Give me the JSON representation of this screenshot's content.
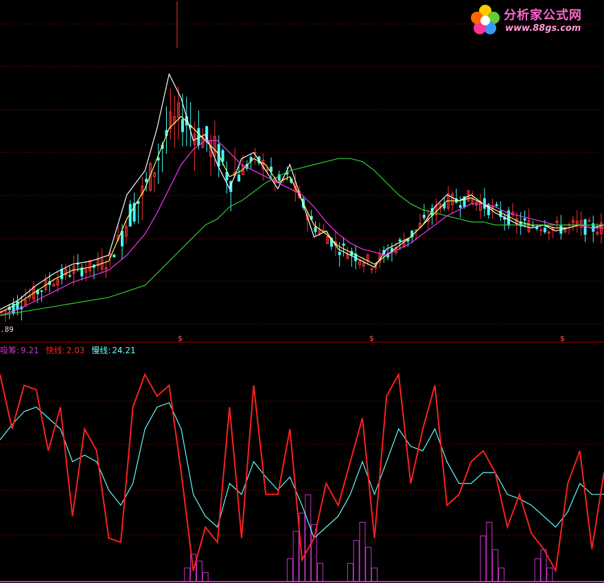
{
  "colors": {
    "background": "#000000",
    "grid": "#7a0000",
    "divider": "#aa0000",
    "candle_up": "#ff3030",
    "candle_down": "#40ffff",
    "ma_white": "#ffffff",
    "ma_yellow": "#ffff66",
    "ma_magenta": "#ff33ff",
    "ma_green": "#33cc33",
    "xichou": "#cc33cc",
    "fast": "#ff2020",
    "slow": "#66ffff"
  },
  "logo": {
    "title": "分析家公式网",
    "url": "www.88gs.com",
    "icon": "flower-logo-icon"
  },
  "price_panel": {
    "low_label": ".89"
  },
  "signals": {
    "marker": "$",
    "positions": [
      0.3,
      0.615,
      0.93
    ]
  },
  "indicator": {
    "xichou_label": "吸筹:",
    "xichou_value": "9.21",
    "fast_label": "快线:",
    "fast_value": "2.03",
    "slow_label": "慢线:",
    "slow_value": "24.21"
  },
  "chart_data": [
    {
      "type": "candlestick",
      "title": "",
      "series": [
        {
          "name": "",
          "kind": "ma_white",
          "x": [
            0,
            0.03,
            0.06,
            0.09,
            0.12,
            0.15,
            0.18,
            0.21,
            0.24,
            0.26,
            0.28,
            0.3,
            0.32,
            0.34,
            0.36,
            0.38,
            0.4,
            0.42,
            0.44,
            0.46,
            0.48,
            0.5,
            0.52,
            0.54,
            0.56,
            0.58,
            0.6,
            0.62,
            0.64,
            0.66,
            0.68,
            0.7,
            0.72,
            0.74,
            0.76,
            0.78,
            0.8,
            0.82,
            0.84,
            0.86,
            0.88,
            0.9,
            0.92,
            0.94,
            0.96,
            0.98,
            1.0
          ],
          "y": [
            0.02,
            0.05,
            0.1,
            0.14,
            0.17,
            0.18,
            0.2,
            0.4,
            0.48,
            0.62,
            0.8,
            0.72,
            0.58,
            0.6,
            0.5,
            0.42,
            0.52,
            0.54,
            0.48,
            0.42,
            0.5,
            0.38,
            0.26,
            0.28,
            0.22,
            0.2,
            0.18,
            0.16,
            0.22,
            0.24,
            0.26,
            0.3,
            0.36,
            0.4,
            0.38,
            0.4,
            0.37,
            0.34,
            0.32,
            0.3,
            0.29,
            0.3,
            0.28,
            0.29,
            0.3,
            0.29,
            0.3
          ]
        },
        {
          "name": "",
          "kind": "ma_yellow",
          "x": [
            0,
            0.03,
            0.06,
            0.09,
            0.12,
            0.15,
            0.18,
            0.21,
            0.24,
            0.26,
            0.28,
            0.3,
            0.32,
            0.34,
            0.36,
            0.38,
            0.4,
            0.42,
            0.44,
            0.46,
            0.48,
            0.5,
            0.52,
            0.54,
            0.56,
            0.58,
            0.6,
            0.62,
            0.64,
            0.66,
            0.68,
            0.7,
            0.72,
            0.74,
            0.76,
            0.78,
            0.8,
            0.82,
            0.84,
            0.86,
            0.88,
            0.9,
            0.92,
            0.94,
            0.96,
            0.98,
            1.0
          ],
          "y": [
            0.01,
            0.04,
            0.08,
            0.12,
            0.15,
            0.16,
            0.18,
            0.32,
            0.42,
            0.52,
            0.62,
            0.66,
            0.62,
            0.58,
            0.54,
            0.46,
            0.48,
            0.52,
            0.5,
            0.44,
            0.46,
            0.38,
            0.3,
            0.27,
            0.23,
            0.21,
            0.19,
            0.17,
            0.2,
            0.23,
            0.26,
            0.3,
            0.34,
            0.38,
            0.38,
            0.39,
            0.37,
            0.35,
            0.33,
            0.31,
            0.3,
            0.3,
            0.29,
            0.29,
            0.3,
            0.29,
            0.29
          ]
        },
        {
          "name": "",
          "kind": "ma_magenta",
          "x": [
            0,
            0.03,
            0.06,
            0.09,
            0.12,
            0.15,
            0.18,
            0.21,
            0.24,
            0.26,
            0.28,
            0.3,
            0.32,
            0.34,
            0.36,
            0.38,
            0.4,
            0.42,
            0.44,
            0.46,
            0.48,
            0.5,
            0.52,
            0.54,
            0.56,
            0.58,
            0.6,
            0.62,
            0.64,
            0.66,
            0.68,
            0.7,
            0.72,
            0.74,
            0.76,
            0.78,
            0.8,
            0.82,
            0.84,
            0.86,
            0.88,
            0.9,
            0.92,
            0.94,
            0.96,
            0.98,
            1.0
          ],
          "y": [
            0.0,
            0.02,
            0.05,
            0.08,
            0.11,
            0.13,
            0.15,
            0.2,
            0.27,
            0.34,
            0.42,
            0.5,
            0.55,
            0.58,
            0.58,
            0.54,
            0.5,
            0.48,
            0.46,
            0.44,
            0.42,
            0.4,
            0.36,
            0.31,
            0.27,
            0.24,
            0.22,
            0.21,
            0.2,
            0.22,
            0.24,
            0.27,
            0.3,
            0.33,
            0.35,
            0.37,
            0.37,
            0.36,
            0.34,
            0.33,
            0.32,
            0.31,
            0.3,
            0.3,
            0.3,
            0.29,
            0.29
          ]
        },
        {
          "name": "",
          "kind": "ma_green",
          "x": [
            0,
            0.03,
            0.06,
            0.09,
            0.12,
            0.15,
            0.18,
            0.21,
            0.24,
            0.26,
            0.28,
            0.3,
            0.32,
            0.34,
            0.36,
            0.38,
            0.4,
            0.42,
            0.44,
            0.46,
            0.48,
            0.5,
            0.52,
            0.54,
            0.56,
            0.58,
            0.6,
            0.62,
            0.64,
            0.66,
            0.68,
            0.7,
            0.72,
            0.74,
            0.76,
            0.78,
            0.8,
            0.82,
            0.84,
            0.86,
            0.88,
            0.9,
            0.92,
            0.94,
            0.96,
            0.98,
            1.0
          ],
          "y": [
            0.0,
            0.01,
            0.02,
            0.03,
            0.04,
            0.05,
            0.06,
            0.08,
            0.1,
            0.14,
            0.18,
            0.22,
            0.26,
            0.3,
            0.32,
            0.36,
            0.38,
            0.41,
            0.44,
            0.46,
            0.48,
            0.49,
            0.5,
            0.51,
            0.52,
            0.52,
            0.51,
            0.48,
            0.44,
            0.4,
            0.37,
            0.35,
            0.34,
            0.33,
            0.32,
            0.31,
            0.31,
            0.3,
            0.3,
            0.3,
            0.3,
            0.3,
            0.3,
            0.3,
            0.3,
            0.3,
            0.3
          ]
        }
      ]
    },
    {
      "type": "line",
      "title": "",
      "series": [
        {
          "name": "快线",
          "kind": "fast",
          "x": [
            0,
            0.02,
            0.04,
            0.06,
            0.08,
            0.1,
            0.12,
            0.14,
            0.16,
            0.18,
            0.2,
            0.22,
            0.24,
            0.26,
            0.28,
            0.3,
            0.32,
            0.34,
            0.36,
            0.38,
            0.4,
            0.42,
            0.44,
            0.46,
            0.48,
            0.5,
            0.52,
            0.54,
            0.56,
            0.58,
            0.6,
            0.62,
            0.64,
            0.66,
            0.68,
            0.7,
            0.72,
            0.74,
            0.76,
            0.78,
            0.8,
            0.82,
            0.84,
            0.86,
            0.88,
            0.9,
            0.92,
            0.94,
            0.96,
            0.98,
            1.0
          ],
          "y": [
            95,
            70,
            90,
            88,
            60,
            80,
            30,
            70,
            60,
            20,
            18,
            80,
            95,
            85,
            90,
            50,
            5,
            25,
            18,
            80,
            20,
            90,
            40,
            40,
            70,
            10,
            20,
            45,
            35,
            55,
            75,
            20,
            85,
            95,
            45,
            70,
            90,
            35,
            40,
            55,
            60,
            50,
            25,
            40,
            22,
            15,
            5,
            45,
            60,
            15,
            50
          ],
          "ylim": [
            0,
            100
          ]
        },
        {
          "name": "慢线",
          "kind": "slow",
          "x": [
            0,
            0.02,
            0.04,
            0.06,
            0.08,
            0.1,
            0.12,
            0.14,
            0.16,
            0.18,
            0.2,
            0.22,
            0.24,
            0.26,
            0.28,
            0.3,
            0.32,
            0.34,
            0.36,
            0.38,
            0.4,
            0.42,
            0.44,
            0.46,
            0.48,
            0.5,
            0.52,
            0.54,
            0.56,
            0.58,
            0.6,
            0.62,
            0.64,
            0.66,
            0.68,
            0.7,
            0.72,
            0.74,
            0.76,
            0.78,
            0.8,
            0.82,
            0.84,
            0.86,
            0.88,
            0.9,
            0.92,
            0.94,
            0.96,
            0.98,
            1.0
          ],
          "y": [
            65,
            72,
            78,
            80,
            75,
            70,
            55,
            58,
            55,
            42,
            35,
            45,
            70,
            80,
            82,
            70,
            40,
            30,
            25,
            45,
            40,
            55,
            48,
            42,
            48,
            35,
            20,
            25,
            30,
            40,
            55,
            40,
            55,
            70,
            62,
            60,
            70,
            55,
            45,
            45,
            50,
            50,
            40,
            38,
            35,
            30,
            25,
            32,
            45,
            40,
            40
          ],
          "ylim": [
            0,
            100
          ]
        },
        {
          "name": "吸筹",
          "kind": "xichou",
          "x": [
            0.31,
            0.32,
            0.33,
            0.34,
            0.48,
            0.49,
            0.5,
            0.51,
            0.52,
            0.53,
            0.58,
            0.59,
            0.6,
            0.61,
            0.62,
            0.8,
            0.81,
            0.82,
            0.83,
            0.89,
            0.9,
            0.91
          ],
          "y": [
            6,
            12,
            9,
            4,
            10,
            22,
            30,
            38,
            25,
            8,
            8,
            18,
            26,
            15,
            6,
            20,
            26,
            14,
            6,
            10,
            14,
            6
          ],
          "ylim": [
            0,
            100
          ]
        }
      ]
    }
  ]
}
